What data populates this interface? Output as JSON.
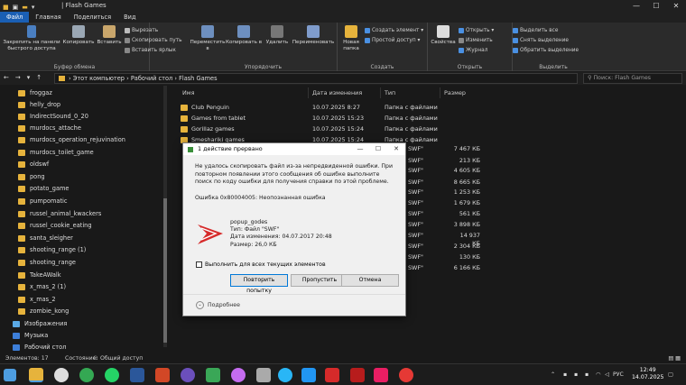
{
  "window": {
    "title": "Flash Games",
    "minimize": "—",
    "maximize": "☐",
    "close": "✕"
  },
  "tabs": [
    "Файл",
    "Главная",
    "Поделиться",
    "Вид"
  ],
  "ribbon": {
    "clipboard": {
      "pin": "Закрепить на панели быстрого доступа",
      "copy": "Копировать",
      "paste": "Вставить",
      "cut": "Вырезать",
      "copy_path": "Скопировать путь",
      "paste_shortcut": "Вставить ярлык",
      "label": "Буфер обмена"
    },
    "organize": {
      "move": "Переместить в",
      "copy_to": "Копировать в",
      "delete": "Удалить",
      "rename": "Переименовать",
      "label": "Упорядочить"
    },
    "create": {
      "new_folder": "Новая папка",
      "new_item": "Создать элемент",
      "easy_access": "Простой доступ",
      "label": "Создать"
    },
    "open": {
      "properties": "Свойства",
      "open": "Открыть",
      "edit": "Изменить",
      "history": "Журнал",
      "label": "Открыть"
    },
    "select": {
      "select_all": "Выделить все",
      "select_none": "Снять выделение",
      "invert": "Обратить выделение",
      "label": "Выделить"
    }
  },
  "address": {
    "path": [
      "Этот компьютер",
      "Рабочий стол",
      "Flash Games"
    ],
    "search_placeholder": "Поиск: Flash Games"
  },
  "sidebar": {
    "items": [
      "froggaz",
      "helly_drop",
      "IndirectSound_0_20",
      "murdocs_attache",
      "murdocs_operation_rejuvination",
      "murdocs_toilet_game",
      "oldswf",
      "pong",
      "potato_game",
      "pumpomatic",
      "russel_animal_kwackers",
      "russel_cookie_eating",
      "santa_sleigher",
      "shooting_range (1)",
      "shooting_range",
      "TakeAWalk",
      "x_mas_2 (1)",
      "x_mas_2",
      "zombie_kong"
    ],
    "pictures": "Изображения",
    "music": "Музыка",
    "desktop": "Рабочий стол"
  },
  "columns": {
    "name": "Имя",
    "date": "Дата изменения",
    "type": "Тип",
    "size": "Размер"
  },
  "files": [
    {
      "name": "Club Penguin",
      "date": "10.07.2025 8:27",
      "type": "Папка с файлами"
    },
    {
      "name": "Games from tablet",
      "date": "10.07.2025 15:23",
      "type": "Папка с файлами"
    },
    {
      "name": "Gorillaz games",
      "date": "10.07.2025 15:24",
      "type": "Папка с файлами"
    },
    {
      "name": "Smeshariki games",
      "date": "10.07.2025 15:24",
      "type": "Папка с файлами"
    }
  ],
  "sizes": [
    "7 467 КБ",
    "213 КБ",
    "4 605 КБ",
    "8 665 КБ",
    "1 253 КБ",
    "1 679 КБ",
    "561 КБ",
    "3 898 КБ",
    "14 937 КБ",
    "2 304 КБ",
    "130 КБ",
    "6 166 КБ"
  ],
  "swf_type": "SWF\"",
  "dialog": {
    "title": "1 действие прервано",
    "message": "Не удалось скопировать файл из-за непредвиденной ошибки. При повторном появлении этого сообщения об ошибке выполните поиск по коду ошибки для получения справки по этой проблеме.",
    "error": "Ошибка 0x80004005: Неопознанная ошибка",
    "file_name": "popup_godes",
    "file_type": "Тип: Файл \"SWF\"",
    "file_date": "Дата изменения: 04.07.2017 20:48",
    "file_size": "Размер: 26,0 КБ",
    "checkbox": "Выполнить для всех текущих элементов",
    "retry": "Повторить попытку",
    "skip": "Пропустить",
    "cancel": "Отмена",
    "details": "Подробнее"
  },
  "status": {
    "count": "Элементов: 17",
    "state": "Состояние:",
    "shared": "Общий доступ"
  },
  "tray": {
    "lang": "РУС",
    "time": "12:49",
    "date": "14.07.2025"
  }
}
